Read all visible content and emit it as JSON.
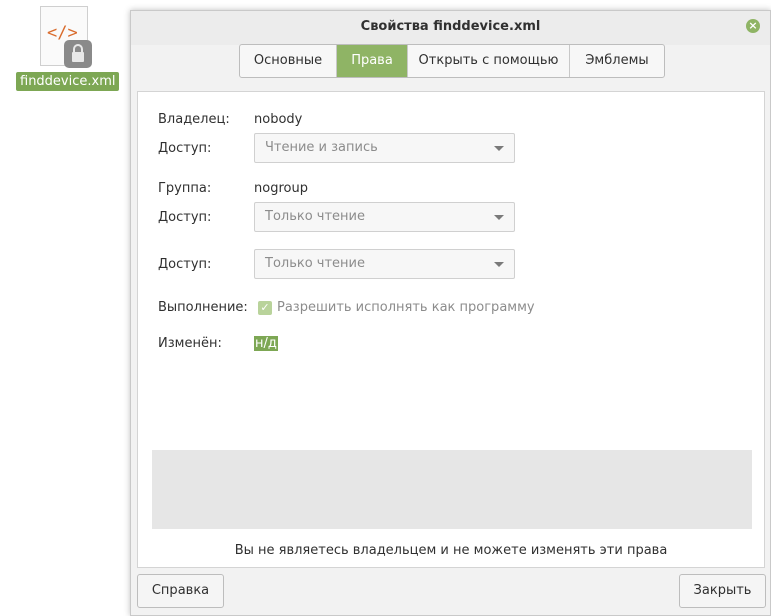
{
  "desktop": {
    "file_icon": "xml-file-icon",
    "code_glyph": "</>",
    "file_name": "finddevice.xml"
  },
  "dialog": {
    "title": "Свойства finddevice.xml",
    "tabs": [
      {
        "label": "Основные",
        "active": false
      },
      {
        "label": "Права",
        "active": true
      },
      {
        "label": "Открыть с помощью",
        "active": false
      },
      {
        "label": "Эмблемы",
        "active": false
      }
    ],
    "permissions": {
      "owner_label": "Владелец:",
      "owner_value": "nobody",
      "owner_access_label": "Доступ:",
      "owner_access_value": "Чтение и запись",
      "group_label": "Группа:",
      "group_value": "nogroup",
      "group_access_label": "Доступ:",
      "group_access_value": "Только чтение",
      "other_access_label": "Доступ:",
      "other_access_value": "Только чтение",
      "execute_label": "Выполнение:",
      "execute_checkbox_label": "Разрешить исполнять как программу",
      "execute_checked": true,
      "modified_label": "Изменён:",
      "modified_value": "н/д"
    },
    "notice": "Вы не являетесь владельцем и не можете изменять эти права",
    "buttons": {
      "help": "Справка",
      "close": "Закрыть"
    }
  },
  "colors": {
    "accent": "#8fb465",
    "selection": "#7da754",
    "code_orange": "#d96b2c"
  }
}
